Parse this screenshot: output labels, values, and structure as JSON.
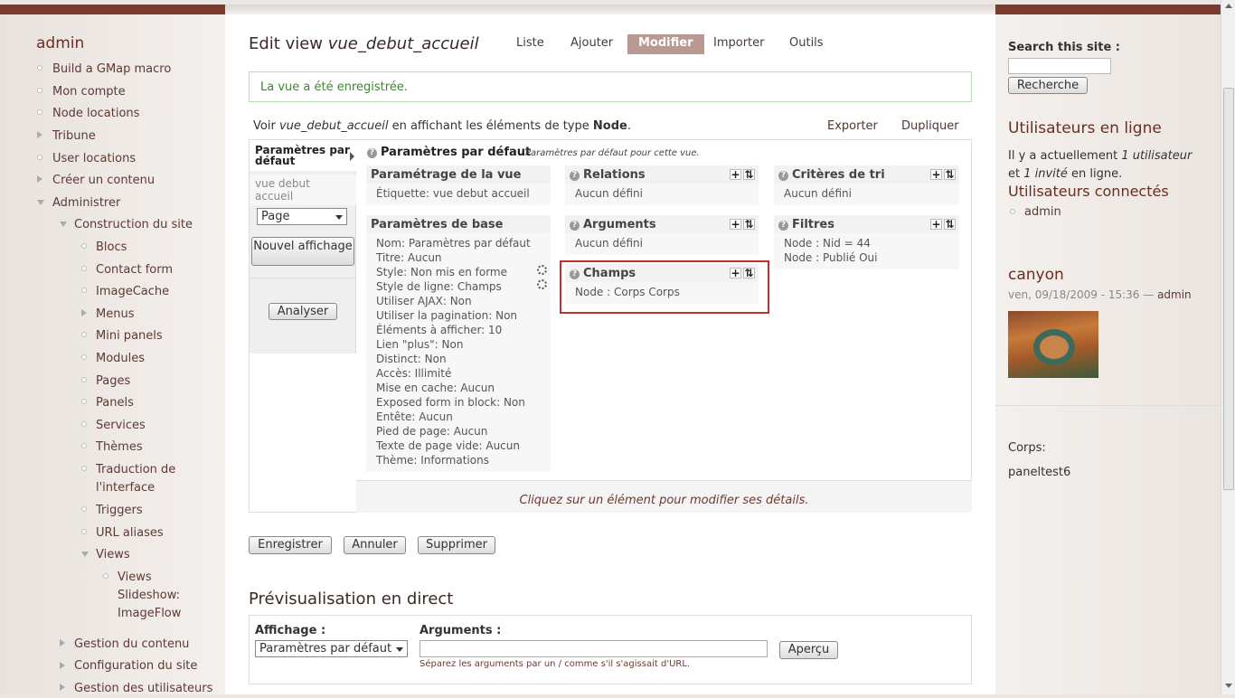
{
  "sidebar": {
    "title": "admin",
    "items": [
      {
        "label": "Build a GMap macro"
      },
      {
        "label": "Mon compte"
      },
      {
        "label": "Node locations"
      },
      {
        "label": "Tribune"
      },
      {
        "label": "User locations"
      },
      {
        "label": "Créer un contenu"
      },
      {
        "label": "Administrer"
      },
      {
        "label": "Construction du site"
      },
      {
        "label": "Blocs"
      },
      {
        "label": "Contact form"
      },
      {
        "label": "ImageCache"
      },
      {
        "label": "Menus"
      },
      {
        "label": "Mini panels"
      },
      {
        "label": "Modules"
      },
      {
        "label": "Pages"
      },
      {
        "label": "Panels"
      },
      {
        "label": "Services"
      },
      {
        "label": "Thèmes"
      },
      {
        "label": "Traduction de l'interface"
      },
      {
        "label": "Triggers"
      },
      {
        "label": "URL aliases"
      },
      {
        "label": "Views"
      },
      {
        "label": "Views Slideshow: ImageFlow"
      },
      {
        "label": "Gestion du contenu"
      },
      {
        "label": "Configuration du site"
      },
      {
        "label": "Gestion des utilisateurs"
      }
    ]
  },
  "header": {
    "title_prefix": "Edit view ",
    "title_view": "vue_debut_accueil",
    "tabs": [
      "Liste",
      "Ajouter",
      "Modifier",
      "Importer",
      "Outils"
    ],
    "active_tab": "Modifier"
  },
  "status_message": "La vue a été enregistrée.",
  "voir": {
    "prefix": "Voir ",
    "view": "vue_debut_accueil",
    "middle": " en affichant les éléments de type ",
    "type": "Node",
    "suffix": ".",
    "export": "Exporter",
    "duplicate": "Dupliquer"
  },
  "displays": {
    "header": "Paramètres par défaut",
    "view_name": "vue debut accueil",
    "select_value": "Page",
    "add_button": "Nouvel affichage",
    "analyze_button": "Analyser"
  },
  "defaults": {
    "title": "Paramètres par défaut",
    "subtitle": "Paramètres par défaut pour cette vue."
  },
  "panels": {
    "view_settings": {
      "title": "Paramétrage de la vue",
      "lines": [
        "Étiquette: vue debut accueil"
      ]
    },
    "basic_settings": {
      "title": "Paramètres de base",
      "lines": [
        "Nom: Paramètres par défaut",
        "Titre: Aucun",
        "Style: Non mis en forme",
        "Style de ligne: Champs",
        "Utiliser AJAX: Non",
        "Utiliser la pagination: Non",
        "Éléments à afficher: 10",
        "Lien \"plus\": Non",
        "Distinct: Non",
        "Accès: Illimité",
        "Mise en cache: Aucun",
        "Exposed form in block: Non",
        "Entête: Aucun",
        "Pied de page: Aucun",
        "Texte de page vide: Aucun",
        "Thème: Informations"
      ]
    },
    "relations": {
      "title": "Relations",
      "lines": [
        "Aucun défini"
      ]
    },
    "arguments": {
      "title": "Arguments",
      "lines": [
        "Aucun défini"
      ]
    },
    "fields": {
      "title": "Champs",
      "lines": [
        "Node : Corps Corps"
      ]
    },
    "sort": {
      "title": "Critères de tri",
      "lines": [
        "Aucun défini"
      ]
    },
    "filters": {
      "title": "Filtres",
      "lines": [
        "Node : Nid = 44",
        "Node : Publié Oui"
      ]
    }
  },
  "footer_hint": "Cliquez sur un élément pour modifier ses détails.",
  "actions": {
    "save": "Enregistrer",
    "cancel": "Annuler",
    "delete": "Supprimer"
  },
  "preview": {
    "title": "Prévisualisation en direct",
    "display_label": "Affichage :",
    "display_value": "Paramètres par défaut",
    "args_label": "Arguments :",
    "args_value": "",
    "hint": "Séparez les arguments par un / comme s'il s'agissait d'URL.",
    "button": "Aperçu"
  },
  "right": {
    "search_label": "Search this site :",
    "search_value": "",
    "search_button": "Recherche",
    "online_title": "Utilisateurs en ligne",
    "online_text_1": "Il y a actuellement ",
    "online_count_users": "1 utilisateur",
    "online_text_2": "et ",
    "online_count_guests": "1 invité",
    "online_text_3": " en ligne.",
    "connected_title": "Utilisateurs connectés",
    "connected_users": [
      "admin"
    ],
    "post_title": "canyon",
    "post_meta": "ven, 09/18/2009 - 15:36 — ",
    "post_author": "admin",
    "corps_label": "Corps:",
    "corps_value": "paneltest6"
  }
}
